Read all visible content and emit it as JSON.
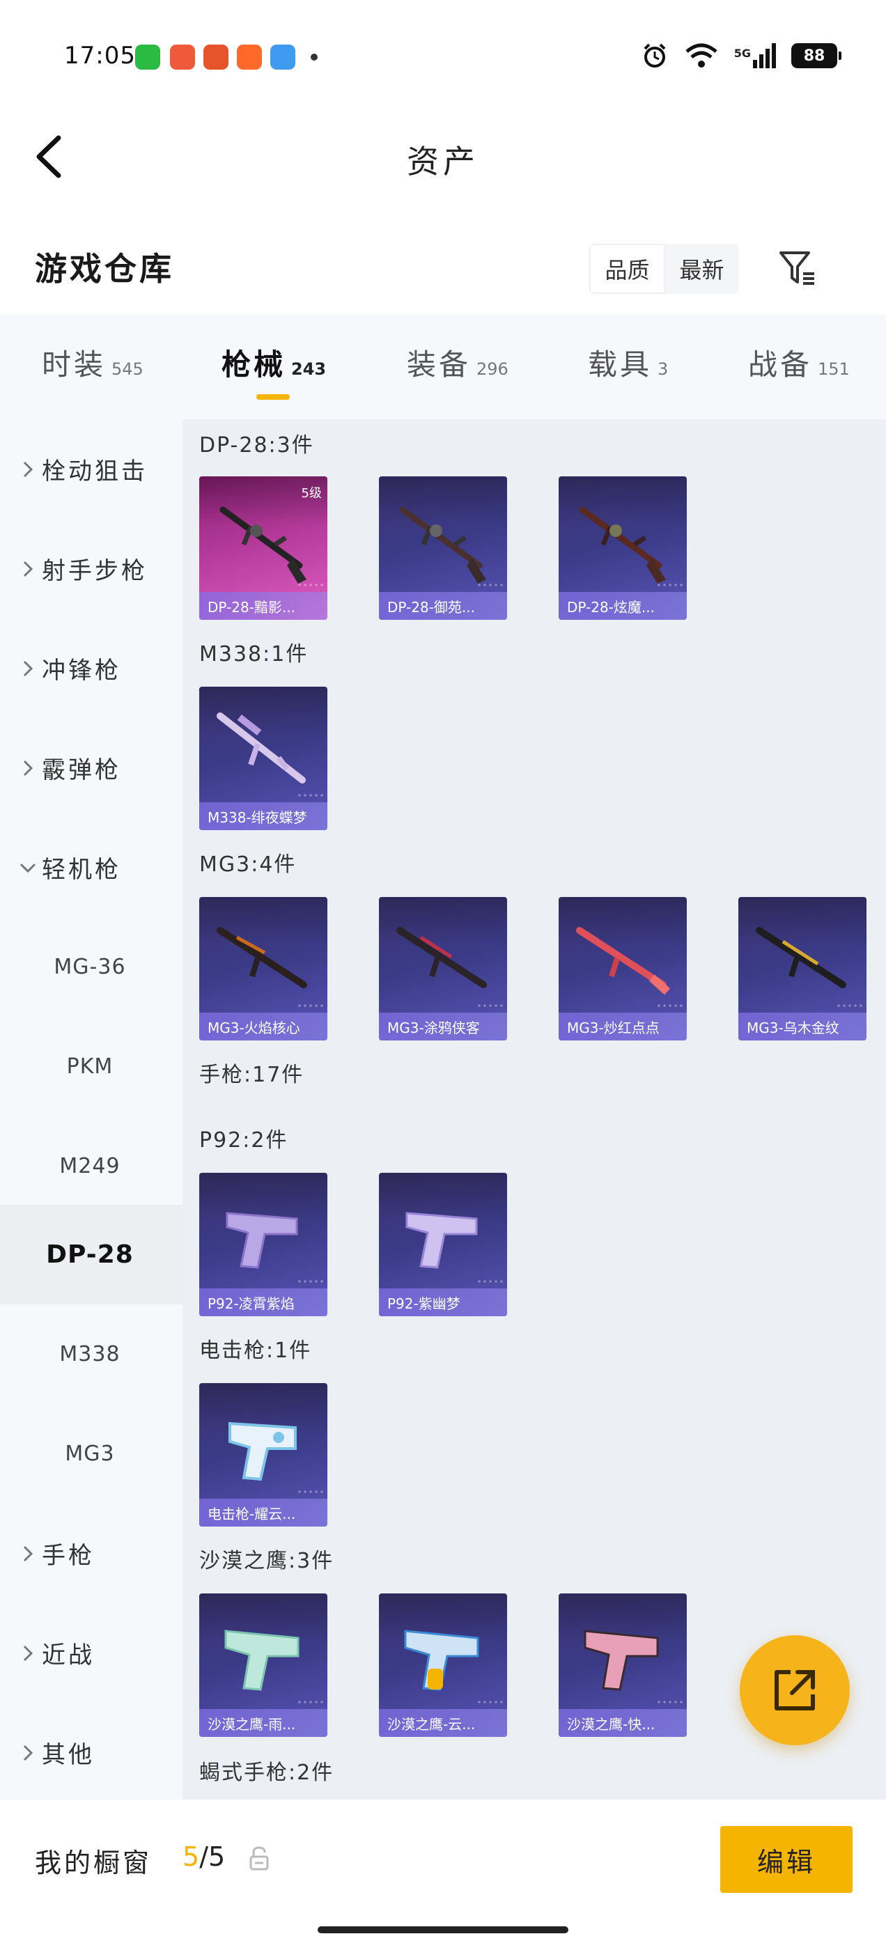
{
  "status_bar": {
    "time": "17:05",
    "network": "5G",
    "battery": "88"
  },
  "header": {
    "title": "资产"
  },
  "section": {
    "title": "游戏仓库",
    "sort_options": [
      "品质",
      "最新"
    ]
  },
  "tabs": [
    {
      "label": "时装",
      "count": "545"
    },
    {
      "label": "枪械",
      "count": "243"
    },
    {
      "label": "装备",
      "count": "296"
    },
    {
      "label": "载具",
      "count": "3"
    },
    {
      "label": "战备",
      "count": "151"
    }
  ],
  "sidebar": {
    "items": [
      {
        "label": "栓动狙击"
      },
      {
        "label": "射手步枪"
      },
      {
        "label": "冲锋枪"
      },
      {
        "label": "霰弹枪"
      },
      {
        "label": "轻机枪"
      },
      {
        "label": "MG-36"
      },
      {
        "label": "PKM"
      },
      {
        "label": "M249"
      },
      {
        "label": "DP-28"
      },
      {
        "label": "M338"
      },
      {
        "label": "MG3"
      },
      {
        "label": "手枪"
      },
      {
        "label": "近战"
      },
      {
        "label": "其他"
      }
    ]
  },
  "content": {
    "groups": [
      {
        "title": "DP-28:3件",
        "items": [
          {
            "name": "DP-28-黯影...",
            "level": "5级"
          },
          {
            "name": "DP-28-御苑..."
          },
          {
            "name": "DP-28-炫魔..."
          }
        ]
      },
      {
        "title": "M338:1件",
        "items": [
          {
            "name": "M338-绯夜蝶梦"
          }
        ]
      },
      {
        "title": "MG3:4件",
        "items": [
          {
            "name": "MG3-火焰核心"
          },
          {
            "name": "MG3-涂鸦侠客"
          },
          {
            "name": "MG3-炒红点点"
          },
          {
            "name": "MG3-乌木金纹"
          }
        ]
      },
      {
        "title": "手枪:17件"
      },
      {
        "title": "P92:2件",
        "items": [
          {
            "name": "P92-凌霄紫焰"
          },
          {
            "name": "P92-紫幽梦"
          }
        ]
      },
      {
        "title": "电击枪:1件",
        "items": [
          {
            "name": "电击枪-耀云..."
          }
        ]
      },
      {
        "title": "沙漠之鹰:3件",
        "items": [
          {
            "name": "沙漠之鹰-雨..."
          },
          {
            "name": "沙漠之鹰-云..."
          },
          {
            "name": "沙漠之鹰-快..."
          }
        ]
      },
      {
        "title": "蝎式手枪:2件"
      }
    ]
  },
  "bottom": {
    "showcase_label": "我的橱窗",
    "showcase_used": "5",
    "showcase_total": "/5",
    "edit_label": "编辑"
  },
  "colors": {
    "accent": "#f5b400",
    "card_purple": "#3a3a86",
    "card_pink": "#b33a9a"
  },
  "icons": [
    "back-arrow-icon",
    "filter-icon",
    "chevron-right-icon",
    "chevron-down-icon",
    "lock-icon",
    "share-icon"
  ]
}
